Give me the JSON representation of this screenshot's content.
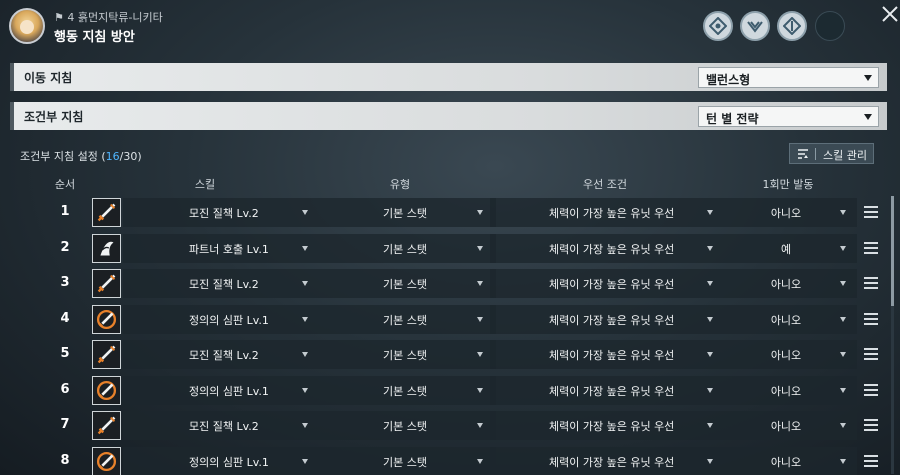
{
  "header": {
    "subtitle": "⚑ 4 흙먼지탁류-니키타",
    "title": "행동 지침 방안",
    "icons": [
      "emblem-icon",
      "emblem-icon",
      "emblem-icon",
      "empty-slot"
    ]
  },
  "movement": {
    "label": "이동 지침",
    "value": "밸런스형"
  },
  "conditional": {
    "label": "조건부 지침",
    "value": "턴 별 전략"
  },
  "settings": {
    "title_prefix": "조건부 지침 설정 (",
    "count": "16",
    "title_suffix": "/30)",
    "manage_label": "스킬 관리"
  },
  "columns": [
    "순서",
    "스킬",
    "유형",
    "우선 조건",
    "1회만 발동"
  ],
  "rows": [
    {
      "num": "1",
      "skill": "모진 질책 Lv.2",
      "type": "기본 스탯",
      "cond": "체력이 가장 높은 유닛 우선",
      "once": "아니오",
      "icon": "sword-icon"
    },
    {
      "num": "2",
      "skill": "파트너 호출 Lv.1",
      "type": "기본 스탯",
      "cond": "체력이 가장 높은 유닛 우선",
      "once": "예",
      "icon": "partner-call-icon"
    },
    {
      "num": "3",
      "skill": "모진 질책 Lv.2",
      "type": "기본 스탯",
      "cond": "체력이 가장 높은 유닛 우선",
      "once": "아니오",
      "icon": "sword-icon"
    },
    {
      "num": "4",
      "skill": "정의의 심판 Lv.1",
      "type": "기본 스탯",
      "cond": "체력이 가장 높은 유닛 우선",
      "once": "아니오",
      "icon": "judgment-icon"
    },
    {
      "num": "5",
      "skill": "모진 질책 Lv.2",
      "type": "기본 스탯",
      "cond": "체력이 가장 높은 유닛 우선",
      "once": "아니오",
      "icon": "sword-icon"
    },
    {
      "num": "6",
      "skill": "정의의 심판 Lv.1",
      "type": "기본 스탯",
      "cond": "체력이 가장 높은 유닛 우선",
      "once": "아니오",
      "icon": "judgment-icon"
    },
    {
      "num": "7",
      "skill": "모진 질책 Lv.2",
      "type": "기본 스탯",
      "cond": "체력이 가장 높은 유닛 우선",
      "once": "아니오",
      "icon": "sword-icon"
    },
    {
      "num": "8",
      "skill": "정의의 심판 Lv.1",
      "type": "기본 스탯",
      "cond": "체력이 가장 높은 유닛 우선",
      "once": "아니오",
      "icon": "judgment-icon"
    }
  ],
  "colors": {
    "accent": "#4fb6ff",
    "icon_orange": "#e8812a"
  }
}
